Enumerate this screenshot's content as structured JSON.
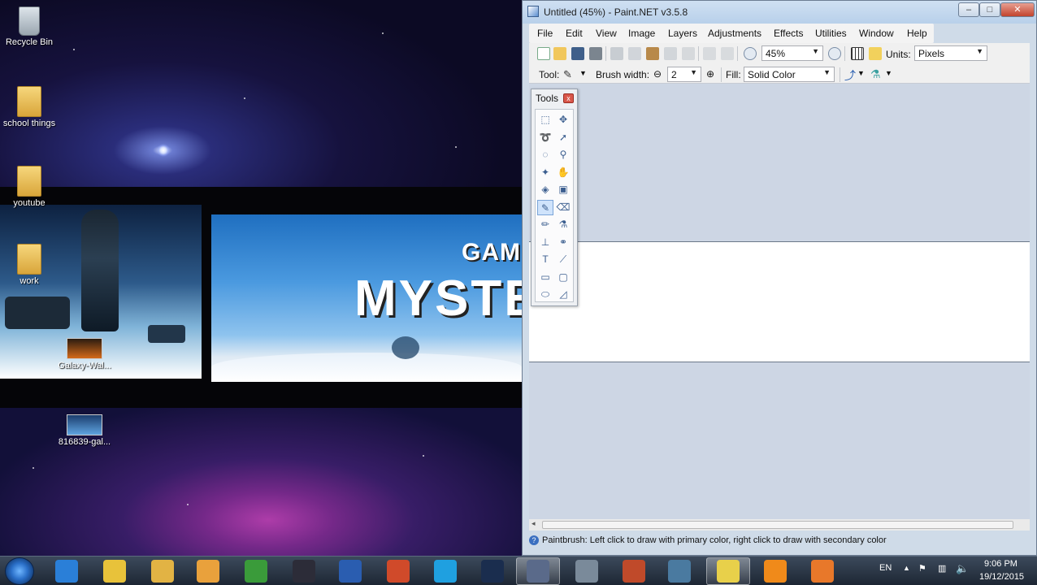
{
  "desktop": {
    "icons": [
      {
        "label": "Recycle Bin",
        "icon": "recycle-bin-icon"
      },
      {
        "label": "school things",
        "icon": "folder-icon"
      },
      {
        "label": "youtube",
        "icon": "folder-icon"
      },
      {
        "label": "work",
        "icon": "folder-icon"
      },
      {
        "label": "Galaxy-Wal...",
        "icon": "image-file-icon"
      },
      {
        "label": "816839-gal...",
        "icon": "image-file-icon"
      }
    ],
    "banner": {
      "line1": "GAMI",
      "line2": "MYSTER"
    }
  },
  "window": {
    "title": "Untitled (45%) - Paint.NET v3.5.8",
    "controls": {
      "minimize": "–",
      "maximize": "□",
      "close": "✕"
    },
    "menu": [
      "File",
      "Edit",
      "View",
      "Image",
      "Layers",
      "Adjustments",
      "Effects",
      "Utilities",
      "Window",
      "Help"
    ],
    "toolbar": {
      "zoom_value": "45%",
      "units_label": "Units:",
      "units_value": "Pixels",
      "tool_label": "Tool:",
      "brush_width_label": "Brush width:",
      "brush_width_value": "2",
      "fill_label": "Fill:",
      "fill_value": "Solid Color"
    },
    "tools_panel": {
      "title": "Tools",
      "close": "x",
      "tools": [
        {
          "name": "rectangle-select-tool-icon",
          "glyph": "⬚"
        },
        {
          "name": "move-selected-pixels-tool-icon",
          "glyph": "✥"
        },
        {
          "name": "lasso-select-tool-icon",
          "glyph": "➰"
        },
        {
          "name": "move-selection-tool-icon",
          "glyph": "➚"
        },
        {
          "name": "ellipse-select-tool-icon",
          "glyph": "◌"
        },
        {
          "name": "zoom-tool-icon",
          "glyph": "⚲"
        },
        {
          "name": "magic-wand-tool-icon",
          "glyph": "✦"
        },
        {
          "name": "pan-tool-icon",
          "glyph": "✋"
        },
        {
          "name": "paint-bucket-tool-icon",
          "glyph": "◈"
        },
        {
          "name": "gradient-tool-icon",
          "glyph": "▣"
        },
        {
          "name": "paintbrush-tool-icon",
          "glyph": "✎"
        },
        {
          "name": "eraser-tool-icon",
          "glyph": "⌫"
        },
        {
          "name": "pencil-tool-icon",
          "glyph": "✏"
        },
        {
          "name": "color-picker-tool-icon",
          "glyph": "⚗"
        },
        {
          "name": "clone-stamp-tool-icon",
          "glyph": "⊥"
        },
        {
          "name": "recolor-tool-icon",
          "glyph": "⚭"
        },
        {
          "name": "text-tool-icon",
          "glyph": "T"
        },
        {
          "name": "line-curve-tool-icon",
          "glyph": "⟋"
        },
        {
          "name": "rectangle-tool-icon",
          "glyph": "▭"
        },
        {
          "name": "rounded-rectangle-tool-icon",
          "glyph": "▢"
        },
        {
          "name": "ellipse-tool-icon",
          "glyph": "⬭"
        },
        {
          "name": "freeform-shape-tool-icon",
          "glyph": "◿"
        }
      ],
      "active_tool": "paintbrush-tool-icon"
    },
    "status": "Paintbrush: Left click to draw with primary color, right click to draw with secondary color"
  },
  "taskbar": {
    "language": "EN",
    "time": "9:06 PM",
    "date": "19/12/2015",
    "apps": [
      "internet-explorer-icon",
      "chrome-icon",
      "file-explorer-icon",
      "media-player-icon",
      "filezilla-icon",
      "audio-app-icon",
      "word-icon",
      "powerpoint-icon",
      "skype-icon",
      "photoshop-icon",
      "paint-net-icon",
      "computer-icon",
      "game-icon",
      "network-app-icon",
      "sticky-notes-icon",
      "vlc-icon",
      "blender-icon"
    ]
  }
}
